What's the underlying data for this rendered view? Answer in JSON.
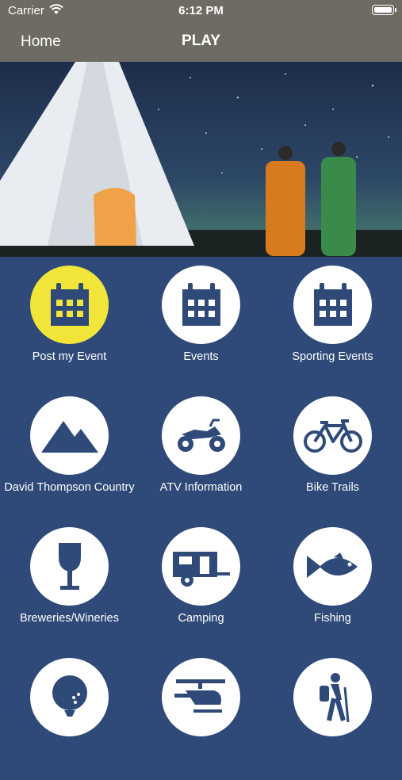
{
  "status_bar": {
    "carrier": "Carrier",
    "time": "6:12 PM"
  },
  "nav": {
    "back_label": "Home",
    "title": "PLAY"
  },
  "tiles": [
    {
      "label": "Post my Event",
      "icon": "calendar-icon",
      "highlight": true
    },
    {
      "label": "Events",
      "icon": "calendar-icon"
    },
    {
      "label": "Sporting Events",
      "icon": "calendar-icon"
    },
    {
      "label": "David Thompson Country",
      "icon": "mountain-icon"
    },
    {
      "label": "ATV Information",
      "icon": "atv-icon"
    },
    {
      "label": "Bike Trails",
      "icon": "bicycle-icon"
    },
    {
      "label": "Breweries/Wineries",
      "icon": "wine-glass-icon"
    },
    {
      "label": "Camping",
      "icon": "camper-trailer-icon"
    },
    {
      "label": "Fishing",
      "icon": "fish-icon"
    },
    {
      "label": "",
      "icon": "golf-ball-icon"
    },
    {
      "label": "",
      "icon": "helicopter-icon"
    },
    {
      "label": "",
      "icon": "hiker-icon"
    }
  ],
  "colors": {
    "grid_bg": "#2f4a78",
    "icon": "#2f4a78",
    "highlight": "#f2e53a",
    "nav_bg": "#6e6b63"
  }
}
